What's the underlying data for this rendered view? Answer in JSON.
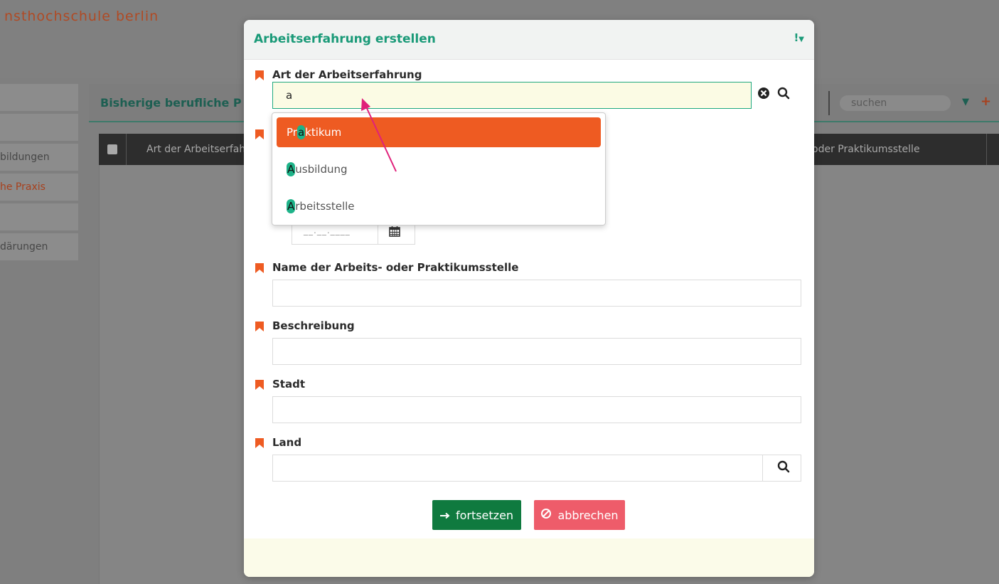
{
  "background": {
    "brand": "nsthochschule berlin",
    "sidebar": [
      "",
      "",
      "bildungen",
      "he Praxis",
      "",
      "därungen"
    ],
    "panel_title": "Bisherige berufliche P",
    "search_placeholder": "suchen",
    "table_headers": [
      "Art der Arbeitserfah",
      "oder Praktikumsstelle"
    ]
  },
  "modal": {
    "title": "Arbeitserfahrung erstellen",
    "fields": {
      "art": {
        "label": "Art der Arbeitserfahrung",
        "value": "a"
      },
      "name": {
        "label": "Name der Arbeits- oder Praktikumsstelle",
        "value": ""
      },
      "beschreibung": {
        "label": "Beschreibung",
        "value": ""
      },
      "stadt": {
        "label": "Stadt",
        "value": ""
      },
      "land": {
        "label": "Land",
        "value": ""
      }
    },
    "date_placeholder": "__.__.____",
    "dropdown": [
      {
        "pre": "Pr",
        "match": "a",
        "post": "ktikum"
      },
      {
        "pre": "",
        "match": "A",
        "post": "usbildung"
      },
      {
        "pre": "",
        "match": "A",
        "post": "rbeitsstelle"
      }
    ],
    "buttons": {
      "continue": "fortsetzen",
      "cancel": "abbrechen"
    }
  },
  "colors": {
    "accent": "#1a9a78",
    "required": "#ee5b22",
    "selected": "#ee5b22",
    "highlight": "#1eb389",
    "primary": "#0f7a3f",
    "danger": "#ee5c6a",
    "annotation": "#e0207a"
  }
}
